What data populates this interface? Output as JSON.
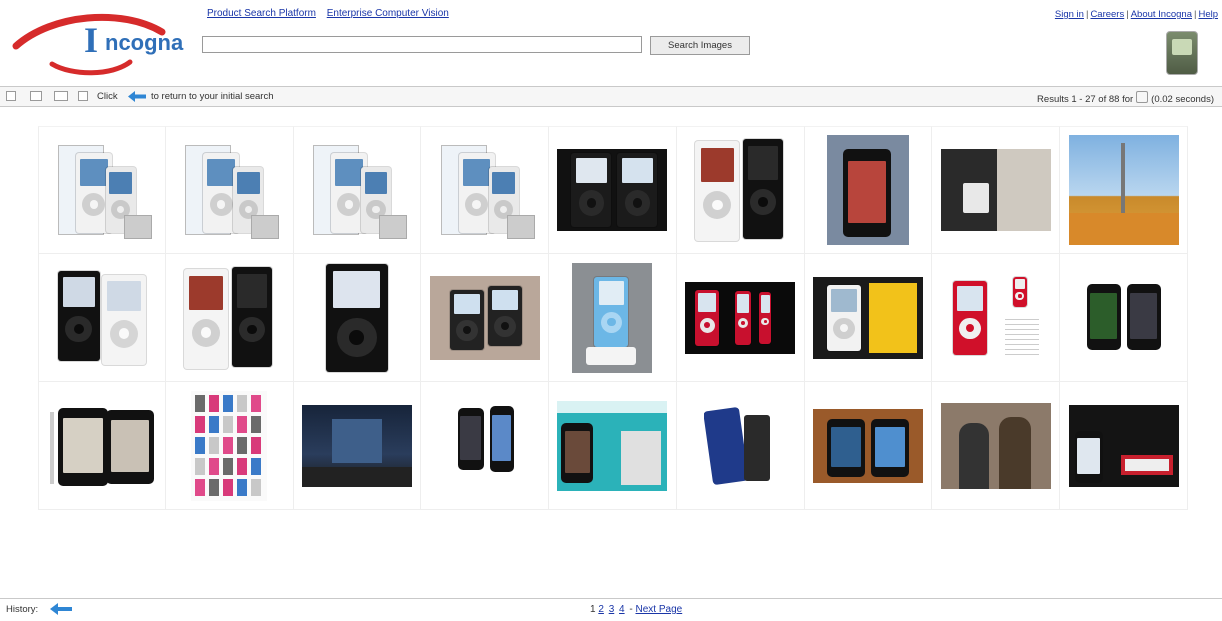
{
  "logo": {
    "text": "Incogna",
    "initial": "I",
    "rest": "ncogna"
  },
  "nav": {
    "links": [
      "Product Search Platform",
      "Enterprise Computer Vision"
    ],
    "right_links": [
      "Sign in",
      "Careers",
      "About Incogna",
      "Help"
    ]
  },
  "search": {
    "value": "",
    "placeholder": "",
    "button_label": "Search Images"
  },
  "toolbar": {
    "click_text": "Click",
    "return_text": "to return to your initial search",
    "results_text": "Results 1 - 27 of 88 for",
    "time_text": "(0.02 seconds)"
  },
  "footer": {
    "history_label": "History:",
    "pages": [
      "1",
      "2",
      "3",
      "4"
    ],
    "next_label": "Next Page"
  },
  "colors": {
    "logo_arc": "#d62b2b",
    "logo_text": "#2f6fb8",
    "link": "#1a36a8",
    "arrow": "#2f86d4"
  },
  "thumbnails": [
    {
      "kind": "product-box-white"
    },
    {
      "kind": "product-box-white"
    },
    {
      "kind": "product-box-white"
    },
    {
      "kind": "product-box-white"
    },
    {
      "kind": "black-pair"
    },
    {
      "kind": "white-black-pair"
    },
    {
      "kind": "photo-phone-hand"
    },
    {
      "kind": "photo-device-table"
    },
    {
      "kind": "photo-tower-city"
    },
    {
      "kind": "black-white-pair"
    },
    {
      "kind": "white-black-pair"
    },
    {
      "kind": "black-single"
    },
    {
      "kind": "photo-hands-pair"
    },
    {
      "kind": "blue-mini-dock"
    },
    {
      "kind": "red-pair-dark"
    },
    {
      "kind": "white-yellow"
    },
    {
      "kind": "red-nano"
    },
    {
      "kind": "touch-pair"
    },
    {
      "kind": "touch-pair-angled"
    },
    {
      "kind": "catalog-sheet"
    },
    {
      "kind": "store-night"
    },
    {
      "kind": "touch-pair-small"
    },
    {
      "kind": "display-stand"
    },
    {
      "kind": "blue-case"
    },
    {
      "kind": "touch-pair-wood"
    },
    {
      "kind": "photo-people"
    },
    {
      "kind": "dark-ad"
    }
  ]
}
